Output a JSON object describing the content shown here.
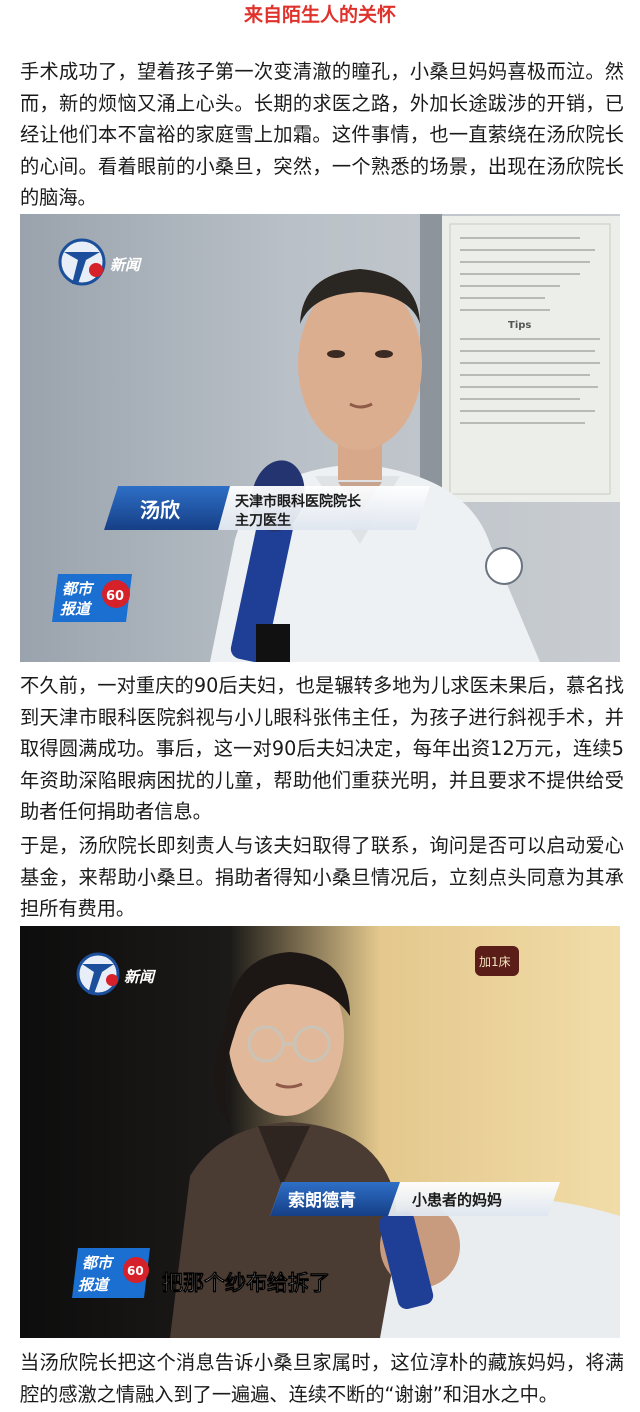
{
  "article": {
    "section_title": "来自陌生人的关怀",
    "paragraphs": [
      "手术成功了，望着孩子第一次变清澈的瞳孔，小桑旦妈妈喜极而泣。然而，新的烦恼又涌上心头。长期的求医之路，外加长途跋涉的开销，已经让他们本不富裕的家庭雪上加霜。这件事情，也一直萦绕在汤欣院长的心间。看着眼前的小桑旦，突然，一个熟悉的场景，出现在汤欣院长的脑海。",
      "不久前，一对重庆的90后夫妇，也是辗转多地为儿求医未果后，慕名找到天津市眼科医院斜视与小儿眼科张伟主任，为孩子进行斜视手术，并取得圆满成功。事后，这一对90后夫妇决定，每年出资12万元，连续5年资助深陷眼病困扰的儿童，帮助他们重获光明，并且要求不提供给受助者任何捐助者信息。",
      "于是，汤欣院长即刻责人与该夫妇取得了联系，询问是否可以启动爱心基金，来帮助小桑旦。捐助者得知小桑旦情况后，立刻点头同意为其承担所有费用。",
      "当汤欣院长把这个消息告诉小桑旦家属时，这位淳朴的藏族妈妈，将满腔的感激之情融入到了一遍遍、连续不断的“谢谢”和泪水之中。"
    ]
  },
  "frame1": {
    "channel_logo_text": "新闻",
    "program_badge": [
      "都市",
      "报道"
    ],
    "program_badge_num": "60",
    "name_tag": "汤欣",
    "title_line1": "天津市眼科医院院长",
    "title_line2": "主刀医生",
    "wall_notice_heading": "Tips"
  },
  "frame2": {
    "channel_logo_text": "新闻",
    "program_badge": [
      "都市",
      "报道"
    ],
    "program_badge_num": "60",
    "bed_sign": "加1床",
    "name_tag": "索朗德青",
    "title_line1": "小患者的妈妈",
    "subtitle": "把那个纱布给拆了"
  },
  "colors": {
    "title_red": "#e0322c",
    "caption_blue": "#1b4f9c",
    "badge_red": "#d6202a"
  }
}
